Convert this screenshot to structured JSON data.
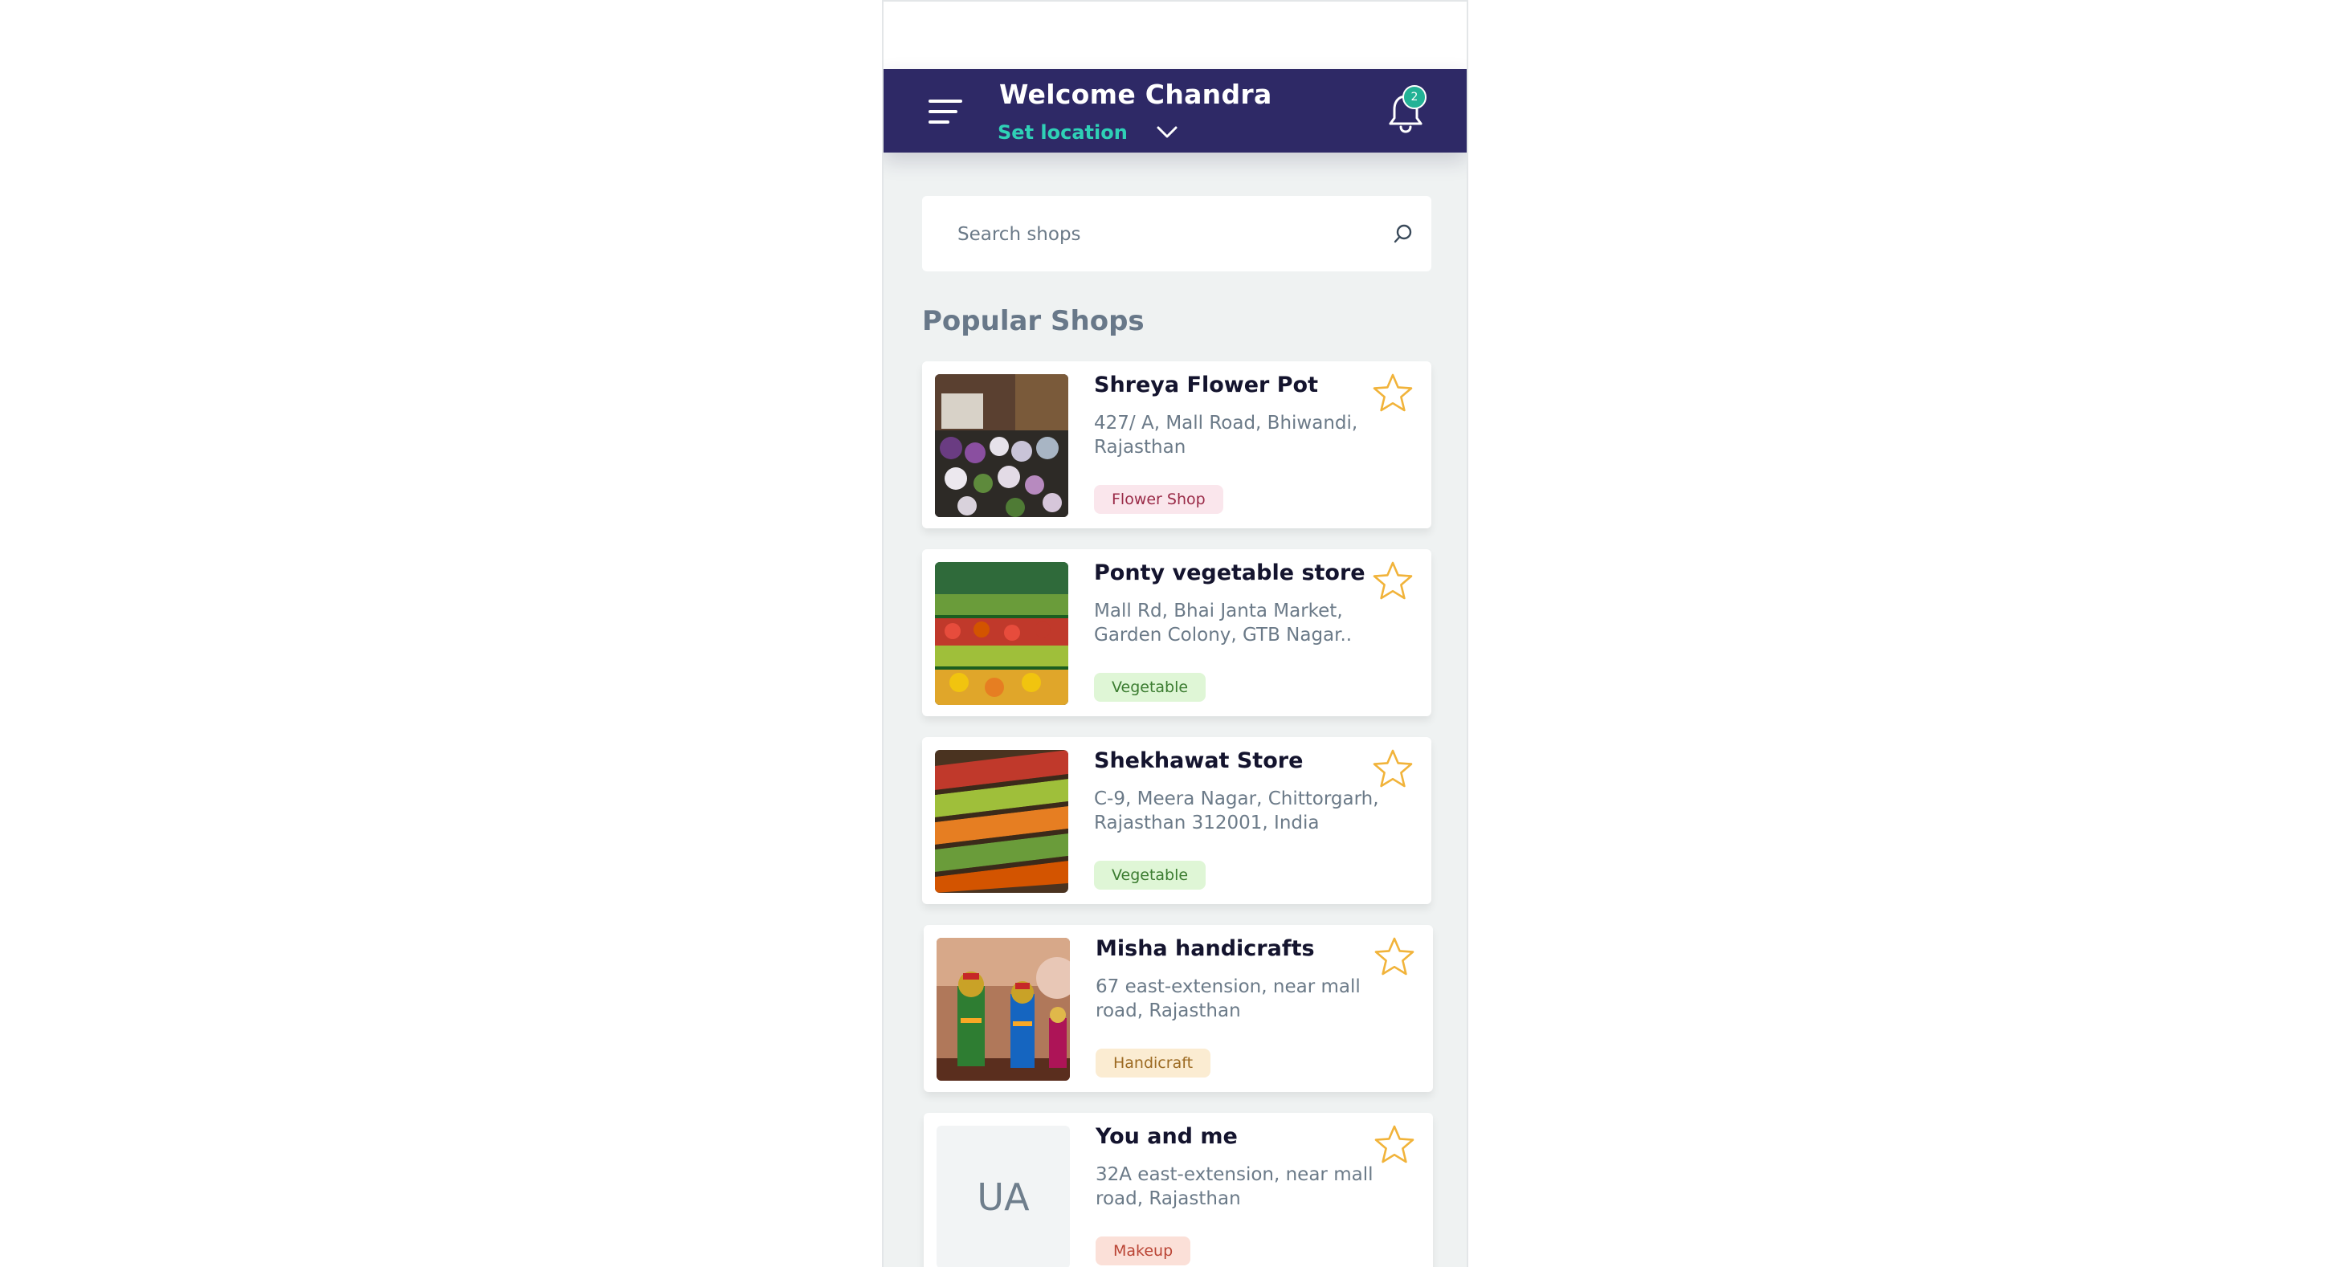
{
  "header": {
    "welcome_text": "Welcome Chandra",
    "location_label": "Set location",
    "notification_count": "2"
  },
  "search": {
    "placeholder": "Search shops"
  },
  "section": {
    "title": "Popular Shops"
  },
  "shops": [
    {
      "name": "Shreya Flower Pot",
      "address": "427/ A, Mall Road, Bhiwandi, Rajasthan",
      "category": "Flower Shop"
    },
    {
      "name": "Ponty vegetable store",
      "address": "Mall Rd, Bhai Janta Market, Garden Colony, GTB Nagar..",
      "category": "Vegetable"
    },
    {
      "name": "Shekhawat Store",
      "address": "C-9, Meera Nagar, Chittorgarh, Rajasthan 312001, India",
      "category": "Vegetable"
    },
    {
      "name": "Misha handicrafts",
      "address": "67 east-extension, near mall road, Rajasthan",
      "category": "Handicraft"
    },
    {
      "name": "You and me",
      "address": "32A east-extension, near mall road, Rajasthan",
      "category": "Makeup",
      "initials": "UA"
    }
  ],
  "colors": {
    "header_bg": "#2e2966",
    "accent_teal": "#2fd1b6",
    "badge_green": "#23b296",
    "star_outline": "#f1b33a",
    "page_bg": "#eff2f2"
  },
  "icons": {
    "menu": "hamburger-menu-icon",
    "chevron": "chevron-down-icon",
    "notifications": "bell-icon",
    "search": "search-icon",
    "favorite": "star-outline-icon"
  }
}
